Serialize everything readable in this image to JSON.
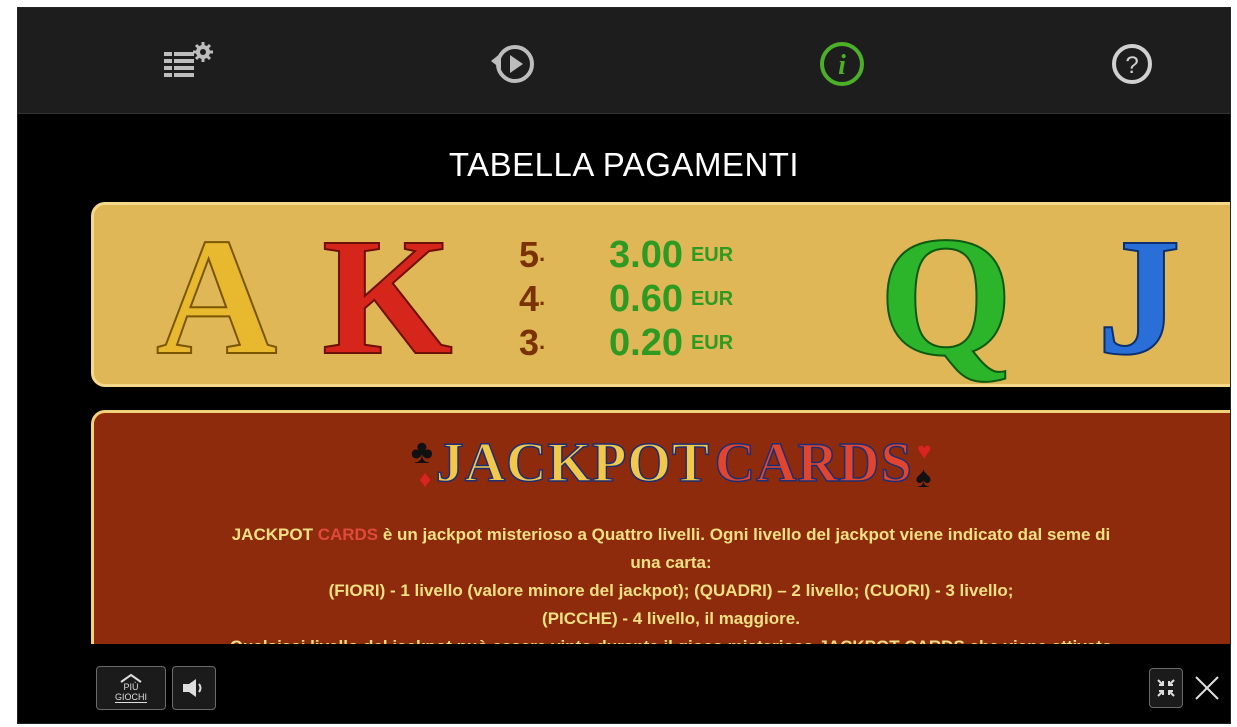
{
  "toolbar": {
    "icons": [
      "settings-stack-icon",
      "autoplay-icon",
      "info-icon",
      "help-icon"
    ],
    "active": "info-icon",
    "active_color": "#4caf28"
  },
  "paytable": {
    "title": "TABELLA PAGAMENTI",
    "symbols_left": [
      "A",
      "K"
    ],
    "symbols_right": [
      "Q",
      "J"
    ],
    "rows": [
      {
        "count": "5",
        "sep": "·",
        "value": "3.00",
        "currency": "EUR"
      },
      {
        "count": "4",
        "sep": "·",
        "value": "0.60",
        "currency": "EUR"
      },
      {
        "count": "3",
        "sep": "·",
        "value": "0.20",
        "currency": "EUR"
      }
    ]
  },
  "jackpot": {
    "logo_word1": "JACKPOT",
    "logo_word2": "CARDS",
    "brand_1": "JACKPOT",
    "brand_2": "CARDS",
    "line1_rest": " è un jackpot misterioso a Quattro livelli. Ogni livello del jackpot viene indicato dal seme di",
    "line2": "una carta:",
    "line3": "(FIORI) - 1 livello (valore minore del jackpot); (QUADRI) – 2 livello; (CUORI) - 3 livello;",
    "line4": "(PICCHE) - 4 livello, il maggiore.",
    "line5": "Qualsiasi livello del jackpot può essere vinto durante il gioco misterioso JACKPOT CARDS che viene attivato"
  },
  "bottom": {
    "more_games_label_1": "PIÙ",
    "more_games_label_2": "GIOCHI"
  },
  "colors": {
    "paytable_bg": "#e0b757",
    "jackpot_bg": "#8e2b0c",
    "payout_green": "#2f9a22",
    "count_brown": "#7a3300"
  }
}
